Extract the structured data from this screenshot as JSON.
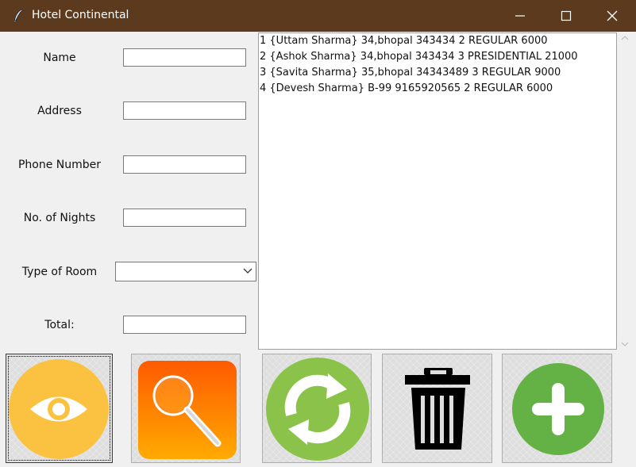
{
  "window": {
    "title": "Hotel Continental",
    "titlebar_color": "#5b3a1d",
    "icon": "feather-icon",
    "controls": [
      "minimize-icon",
      "maximize-icon",
      "close-icon"
    ]
  },
  "form": {
    "name_label": "Name",
    "address_label": "Address",
    "phone_label": "Phone Number",
    "nights_label": "No. of Nights",
    "room_type_label": "Type of Room",
    "total_label": "Total:",
    "name_value": "",
    "address_value": "",
    "phone_value": "",
    "nights_value": "",
    "room_type_value": "",
    "total_value": ""
  },
  "records": [
    "1 {Uttam Sharma} 34,bhopal 343434 2 REGULAR 6000",
    "2 {Ashok Sharma} 34,bhopal 343434 3 PRESIDENTIAL 21000",
    "3 {Savita Sharma} 35,bhopal 34343489 3 REGULAR 9000",
    "4 {Devesh Sharma} B-99 9165920565 2 REGULAR 6000"
  ],
  "toolbar": [
    {
      "icon": "eye-icon",
      "color": "#fbc241"
    },
    {
      "icon": "magnifier-icon",
      "color": "#ff6a00"
    },
    {
      "icon": "refresh-icon",
      "color": "#8bc34a"
    },
    {
      "icon": "trash-icon",
      "color": "#000000"
    },
    {
      "icon": "plus-icon",
      "color": "#64b246"
    }
  ]
}
